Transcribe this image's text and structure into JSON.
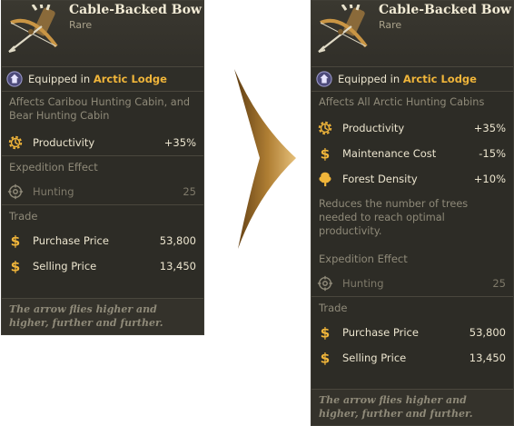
{
  "colors": {
    "panel_bg": "#2d2c26",
    "accent_place": "#f0b53a",
    "muted_text": "#8f8a79",
    "arrow_fill": "#a9782e"
  },
  "before": {
    "item_name": "Cable-Backed Bow",
    "rarity": "Rare",
    "item_icon": "bow-and-quiver-icon",
    "equipped_prefix": "Equipped in ",
    "equipped_place": "Arctic Lodge",
    "affects_text": "Affects Caribou Hunting Cabin, and Bear Hunting Cabin",
    "stats": [
      {
        "icon": "gear-productivity-icon",
        "label": "Productivity",
        "value": "+35%"
      }
    ],
    "expedition_title": "Expedition Effect",
    "expedition": {
      "icon": "crosshair-icon",
      "label": "Hunting",
      "value": "25"
    },
    "trade_title": "Trade",
    "trade": [
      {
        "icon": "dollar-icon",
        "label": "Purchase Price",
        "value": "53,800"
      },
      {
        "icon": "dollar-icon",
        "label": "Selling Price",
        "value": "13,450"
      }
    ],
    "flavor": "The arrow flies higher and higher, further and further."
  },
  "after": {
    "item_name": "Cable-Backed Bow",
    "rarity": "Rare",
    "item_icon": "bow-and-quiver-icon",
    "equipped_prefix": "Equipped in ",
    "equipped_place": "Arctic Lodge",
    "affects_text": "Affects All Arctic Hunting Cabins",
    "stats": [
      {
        "icon": "gear-productivity-icon",
        "label": "Productivity",
        "value": "+35%"
      },
      {
        "icon": "dollar-icon",
        "label": "Maintenance Cost",
        "value": "-15%"
      },
      {
        "icon": "tree-icon",
        "label": "Forest Density",
        "value": "+10%"
      }
    ],
    "stat_note": "Reduces the number of trees needed to reach optimal productivity.",
    "expedition_title": "Expedition Effect",
    "expedition": {
      "icon": "crosshair-icon",
      "label": "Hunting",
      "value": "25"
    },
    "trade_title": "Trade",
    "trade": [
      {
        "icon": "dollar-icon",
        "label": "Purchase Price",
        "value": "53,800"
      },
      {
        "icon": "dollar-icon",
        "label": "Selling Price",
        "value": "13,450"
      }
    ],
    "flavor": "The arrow flies higher and higher, further and further."
  }
}
